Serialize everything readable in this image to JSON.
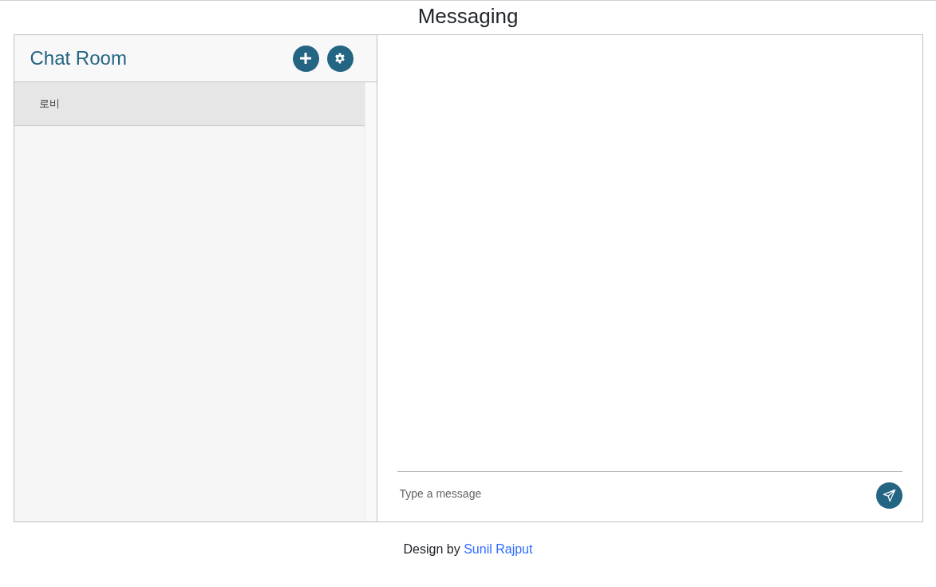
{
  "page_title": "Messaging",
  "sidebar": {
    "title": "Chat Room",
    "rooms": [
      {
        "name": "로비",
        "selected": true
      }
    ]
  },
  "composer": {
    "placeholder": "Type a message"
  },
  "footer": {
    "text": "Design by",
    "link": "Sunil Rajput"
  }
}
